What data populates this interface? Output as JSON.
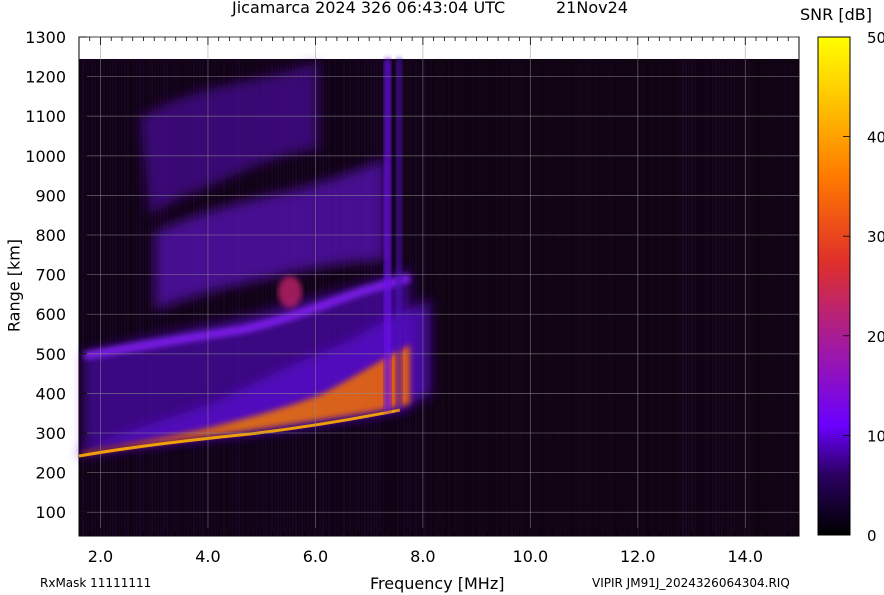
{
  "header": {
    "title": "Jicamarca 2024 326 06:43:04 UTC",
    "date": "21Nov24"
  },
  "footer": {
    "rxmask": "RxMask 11111111",
    "file": "VIPIR  JM91J_2024326064304.RIQ"
  },
  "chart_data": {
    "type": "heatmap",
    "title": "Jicamarca 2024 326 06:43:04 UTC",
    "xlabel": "Frequency [MHz]",
    "ylabel": "Range [km]",
    "xlim": [
      1.6,
      15.0
    ],
    "ylim": [
      40,
      1300
    ],
    "xticks": [
      2.0,
      4.0,
      6.0,
      8.0,
      10.0,
      12.0,
      14.0
    ],
    "xtick_labels": [
      "2.0",
      "4.0",
      "6.0",
      "8.0",
      "10.0",
      "12.0",
      "14.0"
    ],
    "yticks": [
      100,
      200,
      300,
      400,
      500,
      600,
      700,
      800,
      900,
      1000,
      1100,
      1200,
      1300
    ],
    "grid": true,
    "colorbar": {
      "label": "SNR [dB]",
      "range": [
        0,
        50
      ],
      "ticks": [
        0,
        10,
        20,
        30,
        40,
        50
      ],
      "colormap": "gnuplot",
      "stops": [
        "#000000",
        "#3a0078",
        "#7a00ff",
        "#c21a8a",
        "#f05a00",
        "#ffd000",
        "#ffff00"
      ]
    },
    "data_top_km": 1245,
    "traces": [
      {
        "name": "O-trace 1st hop",
        "points": [
          [
            1.6,
            240,
            22
          ],
          [
            2.0,
            248,
            30
          ],
          [
            3.0,
            262,
            34
          ],
          [
            4.0,
            278,
            36
          ],
          [
            5.0,
            295,
            40
          ],
          [
            6.0,
            310,
            42
          ],
          [
            7.0,
            328,
            44
          ],
          [
            7.6,
            345,
            40
          ],
          [
            8.0,
            360,
            18
          ]
        ]
      },
      {
        "name": "2nd hop",
        "points": [
          [
            1.7,
            490,
            14
          ],
          [
            3.0,
            520,
            15
          ],
          [
            4.0,
            550,
            16
          ],
          [
            5.0,
            585,
            18
          ],
          [
            5.6,
            640,
            22
          ],
          [
            6.0,
            605,
            17
          ],
          [
            7.0,
            630,
            15
          ],
          [
            7.5,
            660,
            14
          ]
        ]
      },
      {
        "name": "3rd hop",
        "points": [
          [
            3.0,
            800,
            12
          ],
          [
            4.0,
            840,
            13
          ],
          [
            5.0,
            880,
            12
          ],
          [
            6.0,
            930,
            11
          ],
          [
            7.0,
            950,
            10
          ]
        ]
      },
      {
        "name": "4th hop",
        "points": [
          [
            2.9,
            1080,
            9
          ],
          [
            4.0,
            1120,
            10
          ],
          [
            5.0,
            1170,
            9
          ],
          [
            6.0,
            1210,
            8
          ]
        ]
      }
    ]
  }
}
